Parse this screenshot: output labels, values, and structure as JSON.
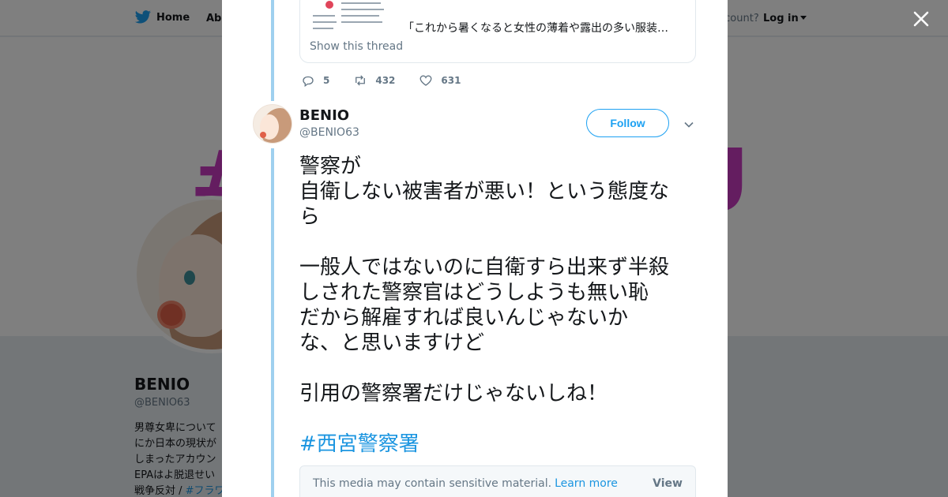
{
  "topnav": {
    "home_label": "Home",
    "about_label": "Abo",
    "account_prompt": "ccount?",
    "login_label": "Log in"
  },
  "profile": {
    "name": "BENIO",
    "handle": "@BENIO63",
    "bio_lines": [
      "男尊女卑について",
      "にか日本の現状が",
      "しまったアカウン",
      "EPAはよ脱退せい",
      "戦争反対 / "
    ],
    "bio_hashtag": "#フラワ",
    "banner_text_left": "#",
    "banner_text_right": "U"
  },
  "quoted": {
    "snippet": "「これから暑くなると女性の薄着や露出の多い服装…",
    "show_thread": "Show this thread"
  },
  "prev_tweet_actions": {
    "replies": "5",
    "retweets": "432",
    "likes": "631"
  },
  "tweet": {
    "author_name": "BENIO",
    "author_handle": "@BENIO63",
    "follow_label": "Follow",
    "lines_1": [
      "警察が",
      "自衛しない被害者が悪い！という態度な",
      "ら"
    ],
    "lines_2": [
      "一般人ではないのに自衛すら出来ず半殺",
      "しされた警察官はどうしようも無い恥",
      "だから解雇すれば良いんじゃないか",
      "な、と思いますけど"
    ],
    "lines_3": [
      "引用の警察署だけじゃないしね！"
    ],
    "hashtag": "#西宮警察署",
    "sensitive_msg": "This media may contain sensitive material.",
    "learn_more": "Learn more",
    "view_label": "View"
  },
  "colors": {
    "accent": "#1da1f2",
    "link": "#1b95e0",
    "thread_line": "#9fd0ef",
    "banner_pink": "#c83ac0"
  }
}
